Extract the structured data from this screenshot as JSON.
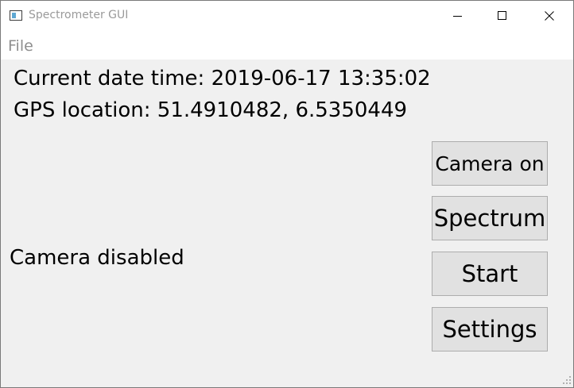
{
  "window": {
    "title": "Spectrometer GUI",
    "icon": "app-window-icon"
  },
  "controls": {
    "minimize_icon": "minimize-icon",
    "maximize_icon": "maximize-icon",
    "close_icon": "close-icon"
  },
  "menu": {
    "file_label": "File"
  },
  "info": {
    "datetime_text": "Current date time: 2019-06-17 13:35:02",
    "gps_text": "GPS location: 51.4910482, 6.5350449"
  },
  "camera": {
    "status_text": "Camera disabled"
  },
  "buttons": {
    "camera_on": "Camera on",
    "spectrum": "Spectrum",
    "start": "Start",
    "settings": "Settings"
  },
  "colors": {
    "window_bg": "#f0f0f0",
    "button_bg": "#e1e1e1",
    "button_border": "#adadad",
    "title_text": "#9a9a9a"
  }
}
